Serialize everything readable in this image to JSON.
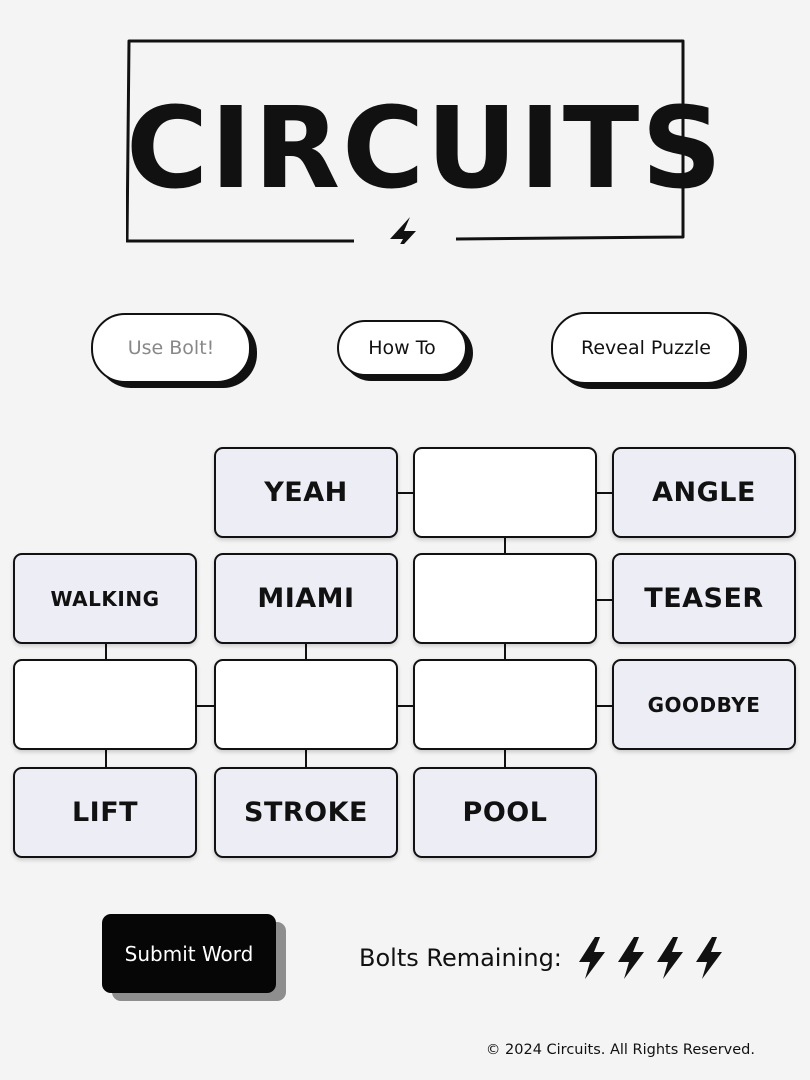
{
  "header": {
    "title": "CIRCUITS",
    "emblem_icon": "lightning-bolt-icon"
  },
  "controls": {
    "use_bolt_label": "Use Bolt!",
    "how_to_label": "How To",
    "reveal_label": "Reveal Puzzle"
  },
  "board": {
    "words": {
      "yeah": "YEAH",
      "angle": "ANGLE",
      "walking": "WALKING",
      "miami": "MIAMI",
      "teaser": "TEASER",
      "goodbye": "GOODBYE",
      "lift": "LIFT",
      "stroke": "STROKE",
      "pool": "POOL"
    },
    "cell_colors": {
      "given": "#ededf5",
      "blank": "#ffffff"
    }
  },
  "footer": {
    "submit_label": "Submit Word",
    "bolts_label": "Bolts Remaining:",
    "bolts_remaining": 4,
    "bolt_icon": "lightning-bolt-icon",
    "copyright": "© 2024 Circuits. All Rights Reserved."
  }
}
